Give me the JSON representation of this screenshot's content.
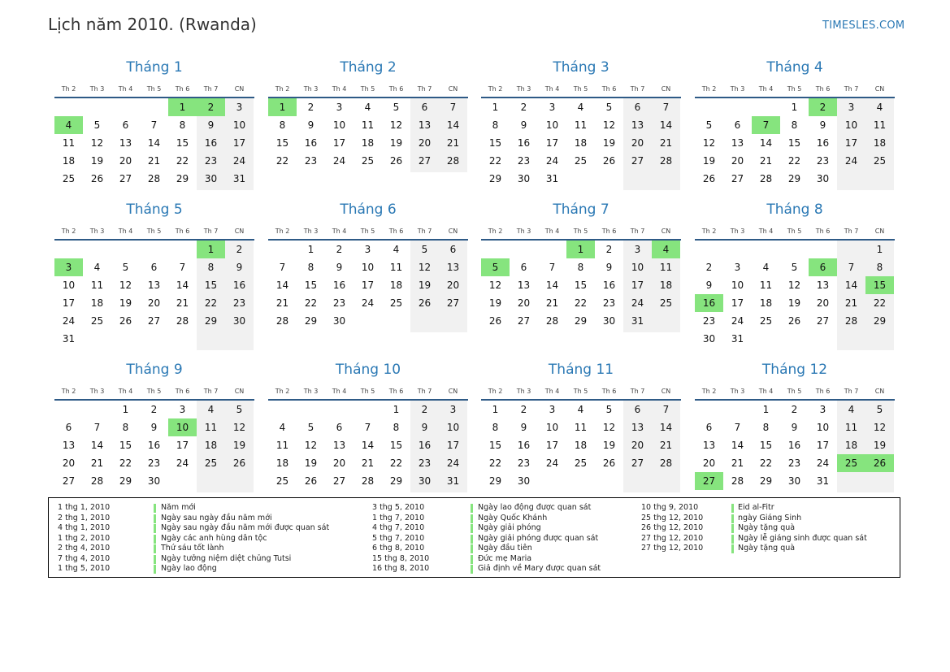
{
  "page": {
    "title": "Lịch năm 2010. (Rwanda)",
    "site": "TIMESLES.COM"
  },
  "weekday_labels": [
    "Th 2",
    "Th 3",
    "Th 4",
    "Th 5",
    "Th 6",
    "Th 7",
    "CN"
  ],
  "colors": {
    "accent": "#2a78b4",
    "holiday": "#86e47e",
    "weekend_bg": "#f1f1f1",
    "rule": "#2e5a86"
  },
  "months": [
    {
      "name": "Tháng 1",
      "first_weekday": 4,
      "days": 31,
      "holidays": [
        1,
        2,
        4
      ]
    },
    {
      "name": "Tháng 2",
      "first_weekday": 0,
      "days": 28,
      "holidays": [
        1
      ]
    },
    {
      "name": "Tháng 3",
      "first_weekday": 0,
      "days": 31,
      "holidays": []
    },
    {
      "name": "Tháng 4",
      "first_weekday": 3,
      "days": 30,
      "holidays": [
        2,
        7
      ]
    },
    {
      "name": "Tháng 5",
      "first_weekday": 5,
      "days": 31,
      "holidays": [
        1,
        3
      ]
    },
    {
      "name": "Tháng 6",
      "first_weekday": 1,
      "days": 30,
      "holidays": []
    },
    {
      "name": "Tháng 7",
      "first_weekday": 3,
      "days": 31,
      "holidays": [
        1,
        4,
        5
      ]
    },
    {
      "name": "Tháng 8",
      "first_weekday": 6,
      "days": 31,
      "holidays": [
        6,
        15,
        16
      ]
    },
    {
      "name": "Tháng 9",
      "first_weekday": 2,
      "days": 30,
      "holidays": [
        10
      ]
    },
    {
      "name": "Tháng 10",
      "first_weekday": 4,
      "days": 31,
      "holidays": []
    },
    {
      "name": "Tháng 11",
      "first_weekday": 0,
      "days": 30,
      "holidays": []
    },
    {
      "name": "Tháng 12",
      "first_weekday": 2,
      "days": 31,
      "holidays": [
        25,
        26,
        27
      ]
    }
  ],
  "holiday_list": [
    {
      "date": "1 thg 1, 2010",
      "name": "Năm mới"
    },
    {
      "date": "2 thg 1, 2010",
      "name": "Ngày sau ngày đầu năm mới"
    },
    {
      "date": "4 thg 1, 2010",
      "name": "Ngày sau ngày đầu năm mới được quan sát"
    },
    {
      "date": "1 thg 2, 2010",
      "name": "Ngày các anh hùng dân tộc"
    },
    {
      "date": "2 thg 4, 2010",
      "name": "Thứ sáu tốt lành"
    },
    {
      "date": "7 thg 4, 2010",
      "name": "Ngày tưởng niệm diệt chủng Tutsi"
    },
    {
      "date": "1 thg 5, 2010",
      "name": "Ngày lao động"
    },
    {
      "date": "3 thg 5, 2010",
      "name": "Ngày lao động được quan sát"
    },
    {
      "date": "1 thg 7, 2010",
      "name": "Ngày Quốc Khánh"
    },
    {
      "date": "4 thg 7, 2010",
      "name": "Ngày giải phóng"
    },
    {
      "date": "5 thg 7, 2010",
      "name": "Ngày giải phóng được quan sát"
    },
    {
      "date": "6 thg 8, 2010",
      "name": "Ngày đầu tiên"
    },
    {
      "date": "15 thg 8, 2010",
      "name": "Đức mẹ Maria"
    },
    {
      "date": "16 thg 8, 2010",
      "name": "Giả định về Mary được quan sát"
    },
    {
      "date": "10 thg 9, 2010",
      "name": "Eid al-Fitr"
    },
    {
      "date": "25 thg 12, 2010",
      "name": "ngày Giáng Sinh"
    },
    {
      "date": "26 thg 12, 2010",
      "name": "Ngày tặng quà"
    },
    {
      "date": "27 thg 12, 2010",
      "name": "Ngày lễ giáng sinh được quan sát"
    },
    {
      "date": "27 thg 12, 2010",
      "name": "Ngày tặng quà"
    }
  ]
}
